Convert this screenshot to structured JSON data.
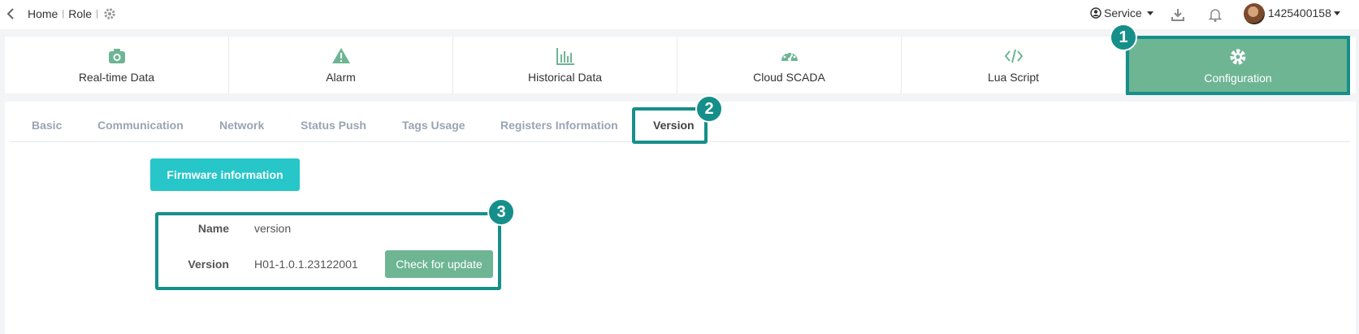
{
  "topbar": {
    "breadcrumb": [
      "Home",
      "Role"
    ],
    "breadcrumb_sep": "|",
    "service_label": "Service",
    "username": "1425400158"
  },
  "modules": [
    {
      "label": "Real-time Data",
      "icon": "camera-icon"
    },
    {
      "label": "Alarm",
      "icon": "warning-icon"
    },
    {
      "label": "Historical Data",
      "icon": "bar-chart-icon"
    },
    {
      "label": "Cloud SCADA",
      "icon": "dashboard-icon"
    },
    {
      "label": "Lua Script",
      "icon": "code-icon"
    },
    {
      "label": "Configuration",
      "icon": "gear-icon",
      "active": true
    }
  ],
  "subtabs": [
    "Basic",
    "Communication",
    "Network",
    "Status Push",
    "Tags Usage",
    "Registers Information",
    "Version"
  ],
  "active_subtab": "Version",
  "firmware": {
    "section_button": "Firmware information",
    "name_label": "Name",
    "name_value": "version",
    "version_label": "Version",
    "version_value": "H01-1.0.1.23122001",
    "check_button": "Check for update"
  },
  "badges": [
    "1",
    "2",
    "3"
  ],
  "colors": {
    "accent_teal": "#168f8a",
    "active_green": "#6eb594",
    "firmware_button": "#26c6c9"
  }
}
